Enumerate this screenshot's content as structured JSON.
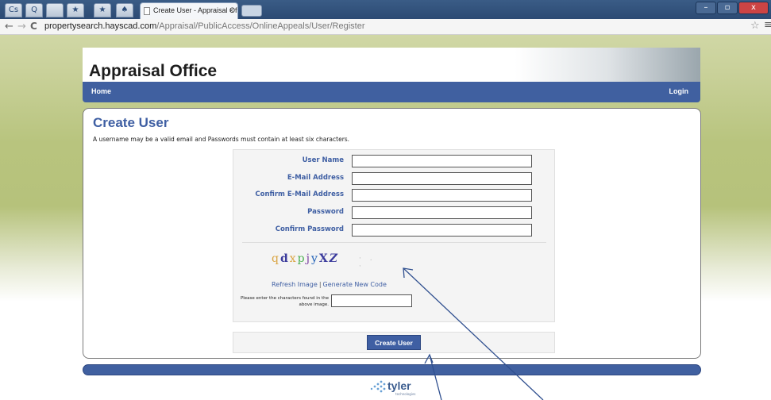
{
  "browser": {
    "tab_title": "Create User - Appraisal Of",
    "tab_close": "×",
    "url_host": "propertysearch.hayscad.com",
    "url_path": "/Appraisal/PublicAccess/OnlineAppeals/User/Register",
    "back": "←",
    "forward": "→",
    "reload": "C",
    "star": "☆",
    "menu": "≡",
    "pinned_tabs": [
      "Cs",
      "Q",
      "",
      "★",
      "★",
      "♠"
    ]
  },
  "site": {
    "title": "Appraisal Office",
    "nav": {
      "home": "Home",
      "login": "Login"
    }
  },
  "page": {
    "heading": "Create User",
    "instructions": "A username may be a valid email and Passwords must contain at least six characters."
  },
  "form": {
    "fields": [
      {
        "label": "User Name",
        "value": ""
      },
      {
        "label": "E-Mail Address",
        "value": ""
      },
      {
        "label": "Confirm E-Mail Address",
        "value": ""
      },
      {
        "label": "Password",
        "value": ""
      },
      {
        "label": "Confirm Password",
        "value": ""
      }
    ],
    "captcha": {
      "chars": [
        "q",
        "d",
        "x",
        "p",
        "j",
        "y",
        "X",
        "Z"
      ],
      "refresh": "Refresh Image",
      "separator": "|",
      "generate": "Generate New Code",
      "prompt": "Please enter the characters found in the above image.",
      "value": ""
    },
    "submit_label": "Create User"
  },
  "footer": {
    "logo_text": "tyler",
    "logo_sub": "technologies"
  },
  "colors": {
    "brand_blue": "#4060a0",
    "heading_blue": "#3f5fa3",
    "annotation_arrow": "#2f4f8f"
  }
}
